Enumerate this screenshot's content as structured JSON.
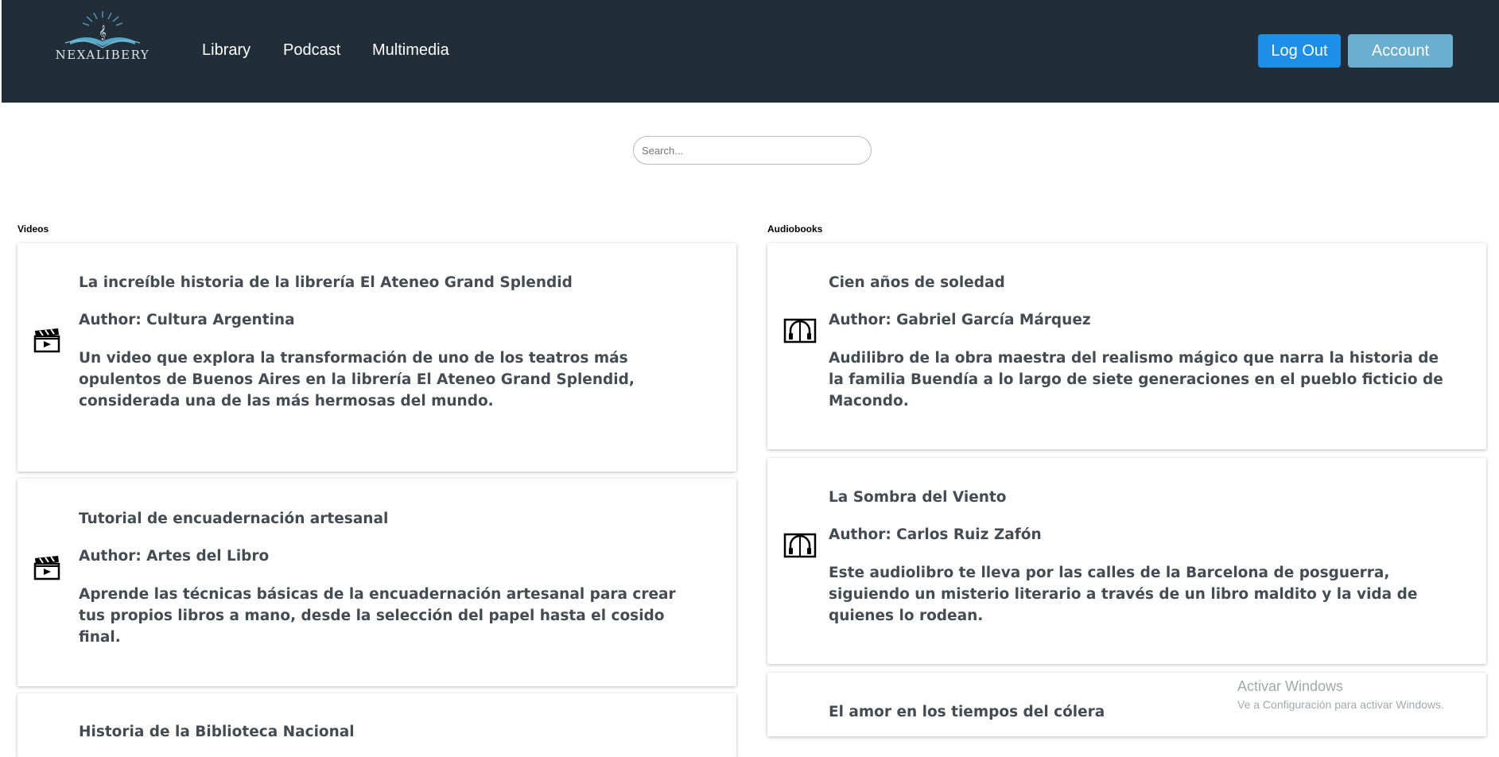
{
  "header": {
    "logo_text": "NEXALIBERY",
    "nav": [
      "Library",
      "Podcast",
      "Multimedia"
    ],
    "logout_label": "Log Out",
    "account_label": "Account"
  },
  "search": {
    "placeholder": "Search...",
    "value": ""
  },
  "videos": {
    "title": "Videos",
    "items": [
      {
        "title": "La increíble historia de la librería El Ateneo Grand Splendid",
        "author": "Author: Cultura Argentina",
        "description": "Un video que explora la transformación de uno de los teatros más opulentos de Buenos Aires en la librería El Ateneo Grand Splendid, considerada una de las más hermosas del mundo.",
        "icon": "clapperboard-icon"
      },
      {
        "title": "Tutorial de encuadernación artesanal",
        "author": "Author: Artes del Libro",
        "description": "Aprende las técnicas básicas de la encuadernación artesanal para crear tus propios libros a mano, desde la selección del papel hasta el cosido final.",
        "icon": "clapperboard-icon"
      },
      {
        "title": "Historia de la Biblioteca Nacional",
        "author": "",
        "description": "",
        "icon": "clapperboard-icon"
      }
    ]
  },
  "audiobooks": {
    "title": "Audiobooks",
    "items": [
      {
        "title": "Cien años de soledad",
        "author": "Author: Gabriel García Márquez",
        "description": "Audilibro de la obra maestra del realismo mágico que narra la historia de la familia Buendía a lo largo de siete generaciones en el pueblo ficticio de Macondo.",
        "icon": "audiobook-icon"
      },
      {
        "title": "La Sombra del Viento",
        "author": "Author: Carlos Ruiz Zafón",
        "description": "Este audiolibro te lleva por las calles de la Barcelona de posguerra, siguiendo un misterio literario a través de un libro maldito y la vida de quienes lo rodean.",
        "icon": "audiobook-icon"
      },
      {
        "title": "El amor en los tiempos del cólera",
        "author": "",
        "description": "",
        "icon": "audiobook-icon"
      }
    ]
  },
  "watermark": {
    "title": "Activar Windows",
    "subtitle": "Ve a Configuración para activar Windows."
  }
}
